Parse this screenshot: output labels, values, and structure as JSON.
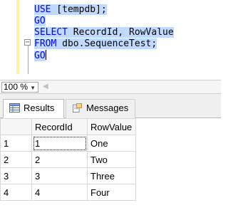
{
  "editor": {
    "lines": [
      {
        "kw": "USE",
        "rest": " [tempdb];"
      },
      {
        "kw": "GO"
      },
      {
        "kw": "SELECT",
        "rest": " RecordId, RowValue"
      },
      {
        "kw": "FROM",
        "rest": " dbo.SequenceTest;"
      },
      {
        "kw": "GO"
      }
    ]
  },
  "zoom": {
    "value": "100 %"
  },
  "tabs": [
    {
      "label": "Results",
      "icon": "grid-icon",
      "active": true
    },
    {
      "label": "Messages",
      "icon": "messages-icon",
      "active": false
    }
  ],
  "grid": {
    "columns": [
      "RecordId",
      "RowValue"
    ],
    "rows": [
      {
        "n": "1",
        "cells": [
          "1",
          "One"
        ]
      },
      {
        "n": "2",
        "cells": [
          "2",
          "Two"
        ]
      },
      {
        "n": "3",
        "cells": [
          "3",
          "Three"
        ]
      },
      {
        "n": "4",
        "cells": [
          "4",
          "Four"
        ]
      }
    ]
  },
  "colors": {
    "selection": "#bfd9ff",
    "keyword": "#0000ff",
    "gutter": "#fff2a8"
  }
}
